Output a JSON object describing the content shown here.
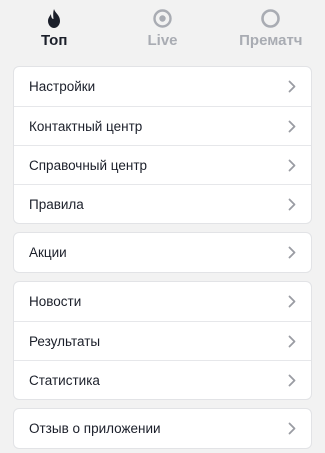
{
  "tabs": [
    {
      "label": "Топ",
      "icon": "fire-icon",
      "active": true
    },
    {
      "label": "Live",
      "icon": "live-dot-icon",
      "active": false
    },
    {
      "label": "Прематч",
      "icon": "circle-outline-icon",
      "active": false
    }
  ],
  "menu": {
    "group1": [
      "Настройки",
      "Контактный центр",
      "Справочный центр",
      "Правила"
    ],
    "group2": [
      "Акции"
    ],
    "group3": [
      "Новости",
      "Результаты",
      "Статистика"
    ],
    "group4": [
      "Отзыв о приложении"
    ]
  },
  "colors": {
    "background": "#f2f2f2",
    "card": "#ffffff",
    "text": "#1b1f2a",
    "inactive": "#a9acb3",
    "chevron": "#9a9ca3"
  }
}
